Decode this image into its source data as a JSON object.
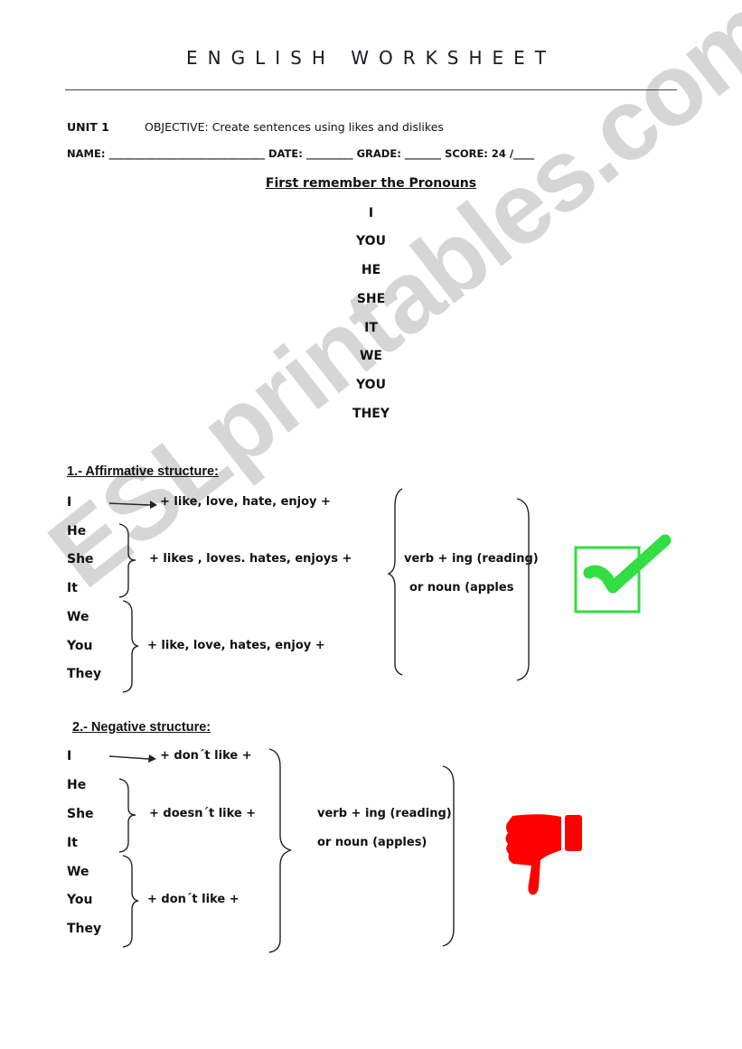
{
  "header": {
    "title": "ENGLISH WORKSHEET",
    "unit": "UNIT 1",
    "objective_label": "OBJECTIVE:",
    "objective_text": "Create sentences using likes and dislikes",
    "name_label": "NAME:",
    "name_blank": "______________________________",
    "date_label": "DATE:",
    "date_blank": "_________",
    "grade_label": "GRADE:",
    "grade_blank": "_______",
    "score_label": "SCORE:",
    "score_value": "24 /____"
  },
  "pronouns": {
    "title": "First remember the Pronouns",
    "items": [
      "I",
      "YOU",
      "HE",
      "SHE",
      "IT",
      "WE",
      "YOU",
      "THEY"
    ]
  },
  "affirmative": {
    "title": "1.- Affirmative structure:",
    "subjects": [
      "I",
      "He",
      "She",
      "It",
      "We",
      "You",
      "They"
    ],
    "row_i": "+   like, love, hate, enjoy  +",
    "row_he": "+    likes , loves. hates, enjoys   +",
    "row_we": "+     like, love, hates, enjoy   +",
    "complement_1": "verb + ing (reading)",
    "complement_2": "or noun  (apples",
    "icon": "green-checkmark",
    "accent": "#33dd44"
  },
  "negative": {
    "title": "2.- Negative structure:",
    "subjects": [
      "I",
      "He",
      "She",
      "It",
      "We",
      "You",
      "They"
    ],
    "row_i": "+   don´t like   +",
    "row_he": "+     doesn´t like      +",
    "row_we": "+      don´t like      +",
    "complement_1": "verb + ing (reading)",
    "complement_2": "or noun  (apples)",
    "icon": "red-thumbs-down",
    "accent": "#ff0000"
  },
  "watermark": "ESLprintables.com"
}
